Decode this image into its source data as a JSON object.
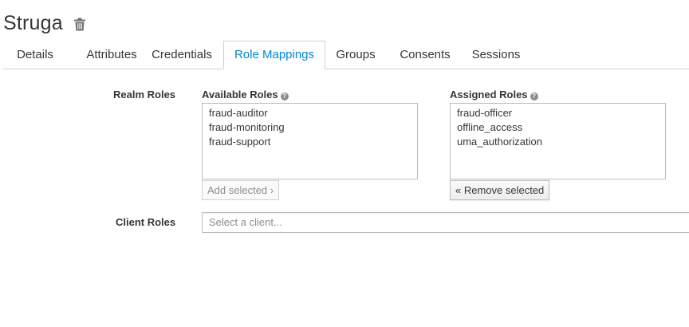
{
  "header": {
    "title": "Struga",
    "delete_icon": "trash-icon"
  },
  "tabs": [
    {
      "label": "Details",
      "active": false
    },
    {
      "label": "Attributes",
      "active": false
    },
    {
      "label": "Credentials",
      "active": false
    },
    {
      "label": "Role Mappings",
      "active": true
    },
    {
      "label": "Groups",
      "active": false
    },
    {
      "label": "Consents",
      "active": false
    },
    {
      "label": "Sessions",
      "active": false
    }
  ],
  "realm_roles": {
    "label": "Realm Roles",
    "available": {
      "label": "Available Roles",
      "items": [
        "fraud-auditor",
        "fraud-monitoring",
        "fraud-support"
      ],
      "button": "Add selected ›"
    },
    "assigned": {
      "label": "Assigned Roles",
      "items": [
        "fraud-officer",
        "offline_access",
        "uma_authorization"
      ],
      "button": "« Remove selected"
    },
    "help_icon": "question-circle-icon"
  },
  "client_roles": {
    "label": "Client Roles",
    "placeholder": "Select a client..."
  },
  "colors": {
    "accent": "#0088ce",
    "text": "#363636",
    "border": "#d1d1d1"
  }
}
